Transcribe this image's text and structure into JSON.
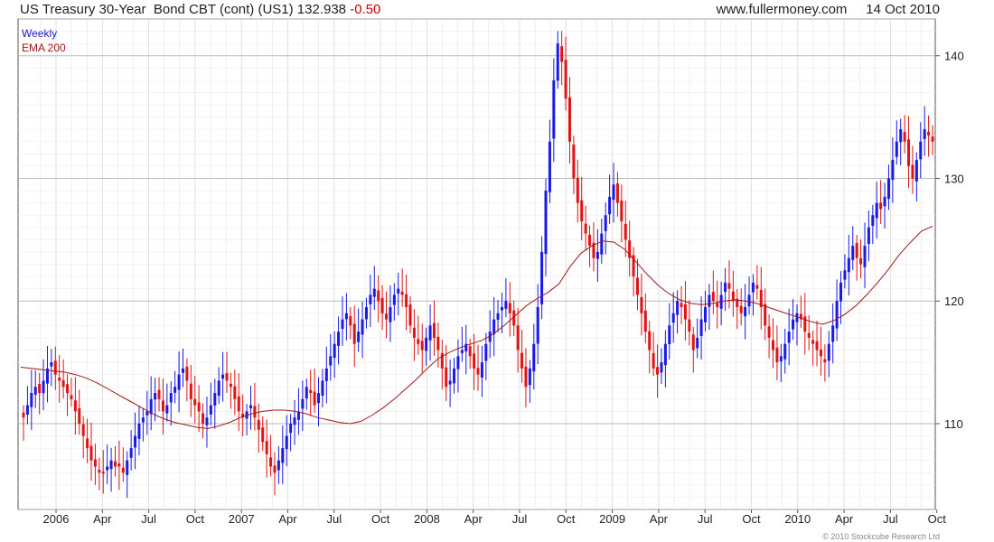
{
  "header": {
    "instrument": "US Treasury 30-Year  Bond CBT (cont) (US1)",
    "last": "132.938",
    "change": "-0.50",
    "source": "www.fullermoney.com",
    "date": "14 Oct 2010"
  },
  "legend": {
    "period": "Weekly",
    "ema": "EMA 200"
  },
  "copyright": "© 2010 Stockcube Research Ltd",
  "colors": {
    "up": "#1a1ae6",
    "down": "#e01414",
    "ema": "#a01818",
    "grid": "#d8d8d8"
  },
  "chart_data": {
    "type": "candlestick",
    "period": "weekly",
    "x_tick_labels": [
      "2006",
      "Apr",
      "Jul",
      "Oct",
      "2007",
      "Apr",
      "Jul",
      "Oct",
      "2008",
      "Apr",
      "Jul",
      "Oct",
      "2009",
      "Apr",
      "Jul",
      "Oct",
      "2010",
      "Apr",
      "Jul",
      "Oct"
    ],
    "y_tick_labels": [
      "110",
      "120",
      "130",
      "140"
    ],
    "ylim": [
      103,
      143
    ],
    "grid": true,
    "closes": [
      110.5,
      111.5,
      112.5,
      113.0,
      112.5,
      113.5,
      114.5,
      115.0,
      114.0,
      113.5,
      113.0,
      112.5,
      112.0,
      111.0,
      110.0,
      109.0,
      108.0,
      107.0,
      106.5,
      106.0,
      106.0,
      106.5,
      107.0,
      106.5,
      106.5,
      106.0,
      107.0,
      108.0,
      109.0,
      110.0,
      110.5,
      111.0,
      112.0,
      112.5,
      112.0,
      111.0,
      111.5,
      112.5,
      113.0,
      114.0,
      114.5,
      113.5,
      112.0,
      111.5,
      111.0,
      110.0,
      110.5,
      111.5,
      112.5,
      113.5,
      114.0,
      113.5,
      113.0,
      112.0,
      111.0,
      110.5,
      111.0,
      111.5,
      110.5,
      109.5,
      108.5,
      107.5,
      106.5,
      106.0,
      107.0,
      108.0,
      109.0,
      110.0,
      110.5,
      111.0,
      112.0,
      113.0,
      112.5,
      111.5,
      112.5,
      113.5,
      114.5,
      115.5,
      116.5,
      117.5,
      118.5,
      119.0,
      118.0,
      116.5,
      117.5,
      118.5,
      119.5,
      120.5,
      121.0,
      120.0,
      119.0,
      118.5,
      119.5,
      120.5,
      121.0,
      120.5,
      119.5,
      118.0,
      117.0,
      116.5,
      116.0,
      117.0,
      118.0,
      117.0,
      116.0,
      114.5,
      113.0,
      113.5,
      114.5,
      115.5,
      116.0,
      116.5,
      115.5,
      114.5,
      114.0,
      115.0,
      116.5,
      117.5,
      118.5,
      119.0,
      119.5,
      120.0,
      119.0,
      118.0,
      116.0,
      114.5,
      113.0,
      114.5,
      116.5,
      119.5,
      124.0,
      129.0,
      133.0,
      138.0,
      141.0,
      139.5,
      136.5,
      133.0,
      130.0,
      128.0,
      126.5,
      125.5,
      124.5,
      123.5,
      124.0,
      125.5,
      127.0,
      128.5,
      129.5,
      128.0,
      126.5,
      125.0,
      123.5,
      122.0,
      120.5,
      119.0,
      117.5,
      116.0,
      114.5,
      114.0,
      115.0,
      116.5,
      118.0,
      119.0,
      120.0,
      119.5,
      118.5,
      117.5,
      116.0,
      117.0,
      118.5,
      119.5,
      120.5,
      120.0,
      119.5,
      120.5,
      121.5,
      121.0,
      120.0,
      119.5,
      119.0,
      119.5,
      120.5,
      121.5,
      121.0,
      119.5,
      118.0,
      117.0,
      116.0,
      115.0,
      115.5,
      116.5,
      117.5,
      118.5,
      119.0,
      118.5,
      117.5,
      117.0,
      116.5,
      116.0,
      115.5,
      115.0,
      116.5,
      118.0,
      120.0,
      121.5,
      122.5,
      123.5,
      124.5,
      123.5,
      123.0,
      124.5,
      126.0,
      127.0,
      128.0,
      127.5,
      128.5,
      130.0,
      131.5,
      133.0,
      134.0,
      133.0,
      131.0,
      130.0,
      131.5,
      133.0,
      134.0,
      133.5,
      133.0
    ],
    "ema_200": [
      114.6,
      114.5,
      114.4,
      114.3,
      114.2,
      114.0,
      113.7,
      113.3,
      112.8,
      112.3,
      111.8,
      111.3,
      110.8,
      110.4,
      110.1,
      109.9,
      109.7,
      109.6,
      109.8,
      110.1,
      110.5,
      110.8,
      111.0,
      111.1,
      111.1,
      111.0,
      110.8,
      110.5,
      110.3,
      110.1,
      110.0,
      110.2,
      110.7,
      111.3,
      112.0,
      112.8,
      113.6,
      114.5,
      115.3,
      115.8,
      116.2,
      116.5,
      116.8,
      117.3,
      118.0,
      118.8,
      119.6,
      120.2,
      120.7,
      121.4,
      122.8,
      123.9,
      124.5,
      124.9,
      124.8,
      124.2,
      123.2,
      122.2,
      121.3,
      120.6,
      120.1,
      119.8,
      119.7,
      119.8,
      120.0,
      120.1,
      120.0,
      119.8,
      119.5,
      119.2,
      118.9,
      118.6,
      118.3,
      118.1,
      118.4,
      118.9,
      119.6,
      120.5,
      121.5,
      122.6,
      123.8,
      124.8,
      125.7,
      126.1
    ]
  }
}
